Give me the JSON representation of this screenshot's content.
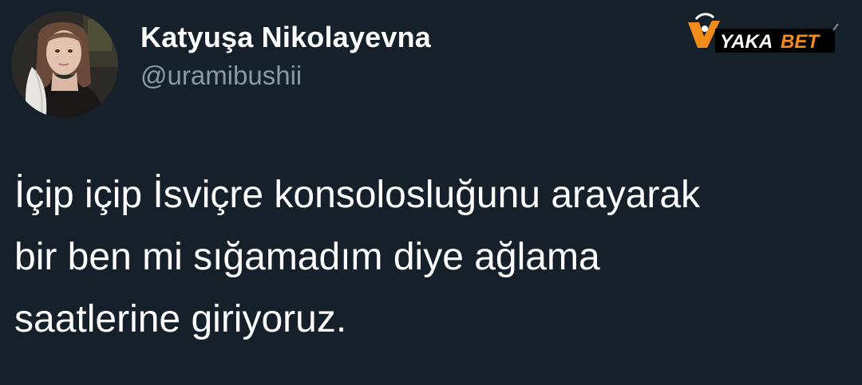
{
  "tweet": {
    "author": {
      "display_name": "Katyuşa Nikolayevna",
      "handle": "@uramibushii"
    },
    "text_lines": [
      "İçip içip İsviçre konsolosluğunu arayarak",
      "bir ben mi sığamadım diye ağlama",
      "saatlerine giriyoruz."
    ]
  },
  "watermark": {
    "text_prefix": "YAKA",
    "text_suffix": "BET",
    "brand_color": "#f28c1a"
  },
  "colors": {
    "background": "#15202b",
    "text": "#ffffff",
    "secondary_text": "#8b98a5"
  }
}
